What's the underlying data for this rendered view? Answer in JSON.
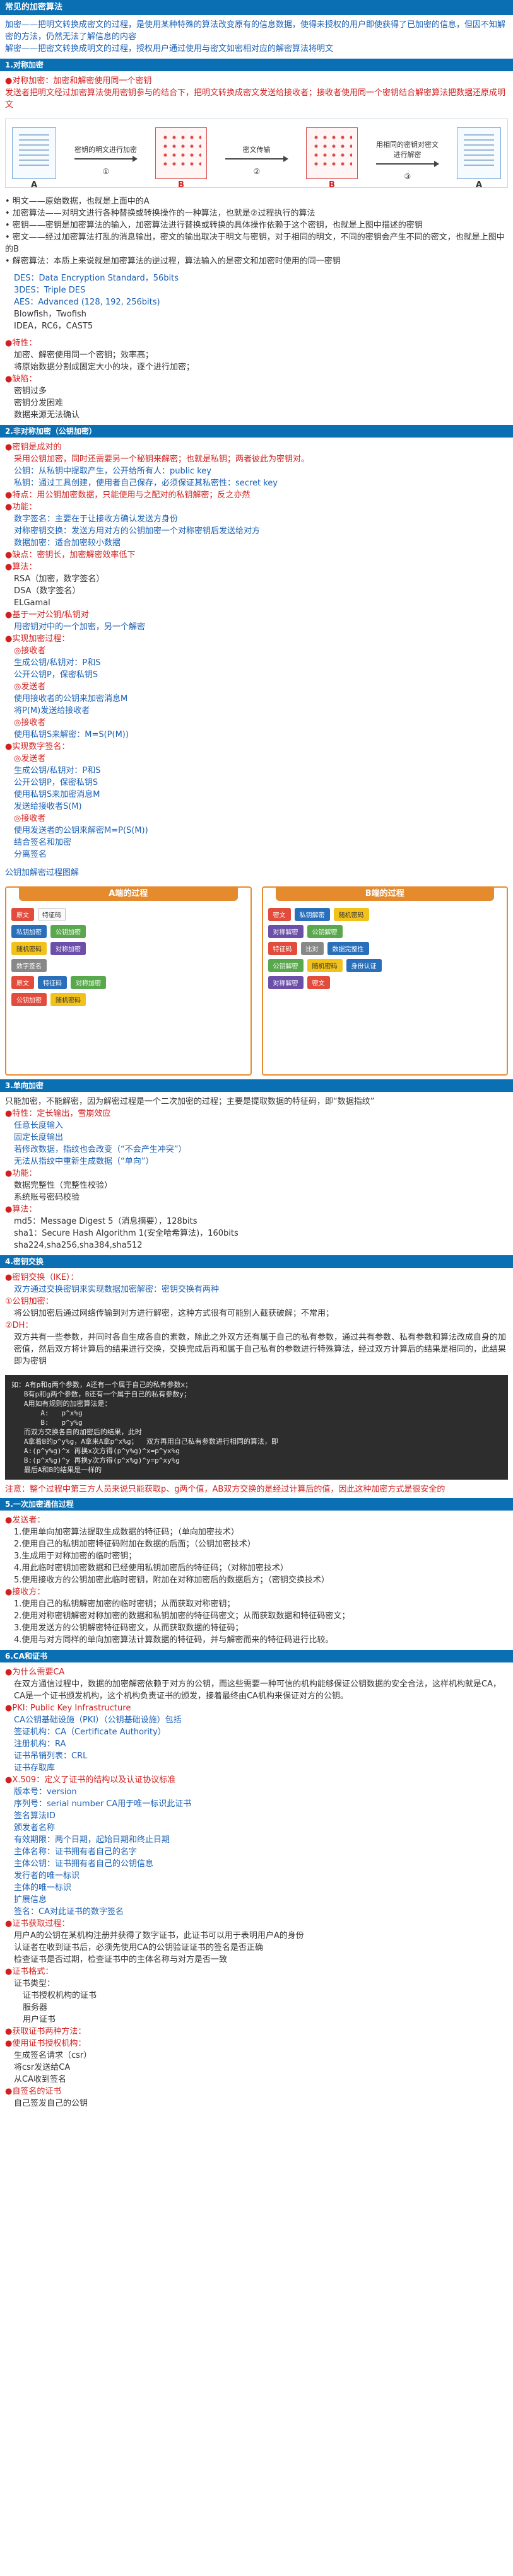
{
  "top_title": "常见的加密算法",
  "intro": [
    "加密——把明文转换成密文的过程，是使用某种特殊的算法改变原有的信息数据，使得未授权的用户即使获得了已加密的信息，但因不知解密的方法，仍然无法了解信息的内容",
    "解密——把密文转换成明文的过程，授权用户通过使用与密文如密相对应的解密算法将明文"
  ],
  "s1": {
    "header": "1.对称加密",
    "lines": [
      "●对称加密：加密和解密使用同一个密钥",
      "发送者把明文经过加密算法使用密钥参与的结合下，把明文转换成密文发送给接收者；接收者使用同一个密钥结合解密算法把数据还原成明文"
    ],
    "diagram": {
      "left_tag": "A",
      "arrow1": "密钥的明文进行加密",
      "mid1_tag": "B",
      "arrow2": "密文传输",
      "mid2_tag": "B",
      "arrow3": "用相同的密钥对密文进行解密",
      "right_tag": "A",
      "n1": "①",
      "n2": "②",
      "n3": "③"
    },
    "terms": [
      "• 明文——原始数据，也就是上面中的A",
      "• 加密算法——对明文进行各种替换或转换操作的一种算法，也就是②过程执行的算法",
      "• 密钥——密钥是加密算法的输入，加密算法进行替换或转换的具体操作依赖于这个密钥，也就是上图中描述的密钥",
      "• 密文——经过加密算法打乱的消息输出，密文的输出取决于明文与密钥，对于相同的明文，不同的密钥会产生不同的密文，也就是上图中的B",
      "• 解密算法：本质上来说就是加密算法的逆过程，算法输入的是密文和加密时使用的同一密钥"
    ],
    "algos": [
      "DES：Data Encryption Standard，56bits",
      "3DES：Triple DES",
      "AES：Advanced (128, 192, 256bits)",
      "Blowfish，Twofish",
      "IDEA，RC6，CAST5"
    ],
    "features_title": "●特性：",
    "features": [
      "加密、解密使用同一个密钥；效率高；",
      "将原始数据分割成固定大小的块，逐个进行加密；"
    ],
    "flaws_title": "●缺陷：",
    "flaws": [
      "密钥过多",
      "密钥分发困难",
      "数据来源无法确认"
    ]
  },
  "s2": {
    "header": "2.非对称加密（公钥加密）",
    "lines": [
      "●密钥是成对的",
      "采用公钥加密，同时还需要另一个秘钥来解密；也就是私钥；两者彼此为密钥对。",
      "公钥：从私钥中提取产生，公开给所有人：public key",
      "私钥：通过工具创建，使用者自己保存，必须保证其私密性：secret key",
      "●特点：用公钥加密数据，只能使用与之配对的私钥解密；反之亦然",
      "●功能：",
      "数字签名：主要在于让接收方确认发送方身份",
      "对称密钥交换：发送方用对方的公钥加密一个对称密钥后发送给对方",
      "数据加密：适合加密较小数据",
      "●缺点：密钥长，加密解密效率低下",
      "●算法：",
      "RSA（加密，数字签名）",
      "DSA（数字签名）",
      "ELGamal",
      "●基于一对公钥/私钥对",
      "用密钥对中的一个加密，另一个解密",
      "●实现加密过程：",
      "◎接收者",
      "生成公钥/私钥对：P和S",
      "公开公钥P，保密私钥S",
      "◎发送者",
      "使用接收者的公钥来加密消息M",
      "将P(M)发送给接收者",
      "◎接收者",
      "使用私钥S来解密：M=S(P(M))",
      "●实现数字签名：",
      "◎发送者",
      "生成公钥/私钥对：P和S",
      "公开公钥P，保密私钥S",
      "使用私钥S来加密消息M",
      "发送给接收者S(M)",
      "◎接收者",
      "使用发送者的公钥来解密M=P(S(M))",
      "结合签名和加密",
      "分离签名"
    ],
    "diagram_caption": "公钥加解密过程图解",
    "flow": {
      "left_title": "A端的过程",
      "right_title": "B端的过程",
      "left_items": [
        "原文",
        "特征码",
        "私钥加密",
        "公钥加密",
        "随机密码",
        "对称加密",
        "数字签名"
      ],
      "right_items": [
        "密文",
        "私钥解密",
        "随机密码",
        "对称解密",
        "公钥解密",
        "特征码",
        "比对"
      ],
      "note1": "数据完整性",
      "note2": "身份认证"
    }
  },
  "s3": {
    "header": "3.单向加密",
    "lines": [
      "只能加密，不能解密，因为解密过程是一个二次加密的过程；主要是提取数据的特征码，即“数据指纹”",
      "●特性：定长输出，雪崩效应",
      "任意长度输入",
      "固定长度输出",
      "若修改数据，指纹也会改变（“不会产生冲突”）",
      "无法从指纹中重新生成数据（“单向”）",
      "●功能：",
      "数据完整性（完整性校验）",
      "系统账号密码校验",
      "●算法：",
      "md5：Message Digest 5（消息摘要），128bits",
      "sha1：Secure Hash Algorithm 1(安全哈希算法)，160bits",
      "sha224,sha256,sha384,sha512"
    ]
  },
  "s4": {
    "header": "4.密钥交换",
    "lines": [
      "●密钥交换（IKE）：",
      "双方通过交换密钥来实现数据加密解密：密钥交换有两种",
      "①公钥加密：",
      "将公钥加密后通过网络传输到对方进行解密，这种方式很有可能别人截获破解；不常用；",
      "②DH：",
      "双方共有一些参数，并同时各自生成各自的素数，除此之外双方还有属于自己的私有参数，通过共有参数、私有参数和算法改成自身的加密值，然后双方将计算后的结果进行交换，交换完成后再和属于自己私有的参数进行特殊算法，经过双方计算后的结果是相同的，此结果即为密钥"
    ],
    "code": [
      "如：A有p和g两个参数，A还有一个属于自己的私有参数x；",
      "   B有p和g两个参数，B还有一个属于自己的私有参数y；",
      "   A用如有规则的加密算法是：",
      "       A:   p^x%g",
      "       B:   p^y%g",
      "   而双方交换各自的加密后的结果，此时",
      "   A拿着B的p^y%g，A拿来A拿p^x%g；  双方再用自己私有参数进行相同的算法，即",
      "   A:(p^y%g)^x 再换x次方得(p^y%g)^x=p^yx%g",
      "   B:(p^x%g)^y 再换y次方得(p^x%g)^y=p^xy%g",
      "   最后A和B的结果是一样的"
    ],
    "note": "注意：整个过程中第三方人员来说只能获取p、g两个值，AB双方交换的是经过计算后的值，因此这种加密方式是很安全的"
  },
  "s5": {
    "header": "5.一次加密通信过程",
    "lines": [
      "●发送者：",
      "1.使用单向加密算法提取生成数据的特征码；（单向加密技术）",
      "2.使用自己的私钥加密特征码附加在数据的后面；（公钥加密技术）",
      "3.生成用于对称加密的临时密钥；",
      "4.用此临时密钥加密数据和已经使用私钥加密后的特征码；（对称加密技术）",
      "5.使用接收方的公钥加密此临时密钥，附加在对称加密后的数据后方；（密钥交换技术）",
      "●接收方：",
      "1.使用自己的私钥解密加密的临时密钥；从而获取对称密钥；",
      "2.使用对称密钥解密对称加密的数据和私钥加密的特征码密文；从而获取数据和特征码密文；",
      "3.使用发送方的公钥解密特征码密文，从而获取数据的特征码；",
      "4.使用与对方同样的单向加密算法计算数据的特征码，并与解密而来的特征码进行比较。"
    ]
  },
  "s6": {
    "header": "6.CA和证书",
    "lines": [
      "●为什么需要CA",
      "在双方通信过程中，数据的加密解密依赖于对方的公钥，而这些需要一种可信的机构能够保证公钥数据的安全合法，这样机构就是CA，CA是一个证书颁发机构，这个机构负责证书的颁发，接着最终由CA机构来保证对方的公钥。",
      "●PKI: Public Key Infrastructure",
      "CA公钥基础设施（PKI）（公钥基础设施）包括",
      "签证机构：CA（Certificate Authority）",
      "注册机构：RA",
      "证书吊销列表：CRL",
      "证书存取库",
      "●X.509：定义了证书的结构以及认证协议标准",
      "版本号：version",
      "序列号：serial number CA用于唯一标识此证书",
      "签名算法ID",
      "颁发者名称",
      "有效期限：两个日期，起始日期和终止日期",
      "主体名称：证书拥有者自己的名字",
      "主体公钥：证书拥有者自己的公钥信息",
      "发行者的唯一标识",
      "主体的唯一标识",
      "扩展信息",
      "签名：CA对此证书的数字签名",
      "●证书获取过程：",
      "用户A的公钥在某机构注册并获得了数字证书，此证书可以用于表明用户A的身份",
      "认证者在收到证书后，必须先使用CA的公钥验证证书的签名是否正确",
      "检查证书是否过期，检查证书中的主体名称与对方是否一致",
      "●证书格式：",
      "证书类型：",
      "证书授权机构的证书",
      "服务器",
      "用户证书",
      "●获取证书两种方法：",
      "●使用证书授权机构：",
      "生成签名请求（csr）",
      "将csr发送给CA",
      "从CA收到签名",
      "●自签名的证书",
      "自己签发自己的公钥"
    ]
  }
}
